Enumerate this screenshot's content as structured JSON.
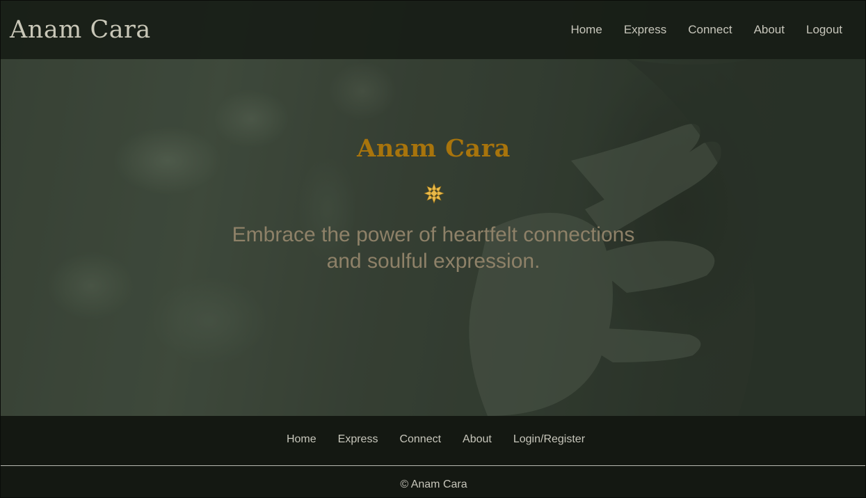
{
  "header": {
    "brand": "Anam Cara",
    "nav": [
      "Home",
      "Express",
      "Connect",
      "About",
      "Logout"
    ]
  },
  "hero": {
    "title": "Anam Cara",
    "emblem_icon": "lotus-emblem-icon",
    "tagline": "Embrace the power of heartfelt connections and soulful expression."
  },
  "footer": {
    "nav": [
      "Home",
      "Express",
      "Connect",
      "About",
      "Login/Register"
    ],
    "copyright": "© Anam Cara"
  },
  "colors": {
    "header_bg": "#161b15",
    "brand_text": "#c9c7b8",
    "hero_title": "#a8740c",
    "emblem": "#e8b94a",
    "tagline": "#8e8168",
    "footer_bg": "#141812",
    "nav_text": "#c7c6bb"
  }
}
